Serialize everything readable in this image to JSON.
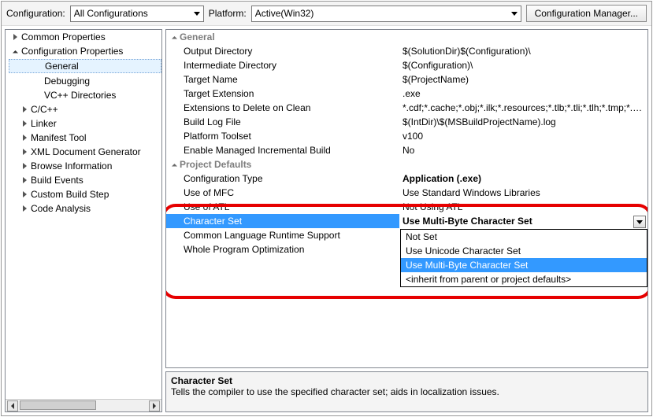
{
  "topbar": {
    "config_label": "Configuration:",
    "config_value": "All Configurations",
    "platform_label": "Platform:",
    "platform_value": "Active(Win32)",
    "manager_btn": "Configuration Manager..."
  },
  "tree": {
    "items": [
      {
        "label": "Common Properties",
        "type": "node",
        "expand": "closed",
        "indent": 0
      },
      {
        "label": "Configuration Properties",
        "type": "node",
        "expand": "open",
        "indent": 0
      },
      {
        "label": "General",
        "type": "leaf",
        "indent": 2,
        "selected": true
      },
      {
        "label": "Debugging",
        "type": "leaf",
        "indent": 2
      },
      {
        "label": "VC++ Directories",
        "type": "leaf",
        "indent": 2
      },
      {
        "label": "C/C++",
        "type": "node",
        "expand": "closed",
        "indent": 1
      },
      {
        "label": "Linker",
        "type": "node",
        "expand": "closed",
        "indent": 1
      },
      {
        "label": "Manifest Tool",
        "type": "node",
        "expand": "closed",
        "indent": 1
      },
      {
        "label": "XML Document Generator",
        "type": "node",
        "expand": "closed",
        "indent": 1
      },
      {
        "label": "Browse Information",
        "type": "node",
        "expand": "closed",
        "indent": 1
      },
      {
        "label": "Build Events",
        "type": "node",
        "expand": "closed",
        "indent": 1
      },
      {
        "label": "Custom Build Step",
        "type": "node",
        "expand": "closed",
        "indent": 1
      },
      {
        "label": "Code Analysis",
        "type": "node",
        "expand": "closed",
        "indent": 1
      }
    ]
  },
  "grid": {
    "groups": [
      {
        "title": "General",
        "rows": [
          {
            "label": "Output Directory",
            "value": "$(SolutionDir)$(Configuration)\\"
          },
          {
            "label": "Intermediate Directory",
            "value": "$(Configuration)\\"
          },
          {
            "label": "Target Name",
            "value": "$(ProjectName)"
          },
          {
            "label": "Target Extension",
            "value": ".exe"
          },
          {
            "label": "Extensions to Delete on Clean",
            "value": "*.cdf;*.cache;*.obj;*.ilk;*.resources;*.tlb;*.tli;*.tlh;*.tmp;*.rsp;"
          },
          {
            "label": "Build Log File",
            "value": "$(IntDir)\\$(MSBuildProjectName).log"
          },
          {
            "label": "Platform Toolset",
            "value": "v100"
          },
          {
            "label": "Enable Managed Incremental Build",
            "value": "No"
          }
        ]
      },
      {
        "title": "Project Defaults",
        "rows": [
          {
            "label": "Configuration Type",
            "value": "Application (.exe)",
            "bold": true
          },
          {
            "label": "Use of MFC",
            "value": "Use Standard Windows Libraries"
          },
          {
            "label": "Use of ATL",
            "value": "Not Using ATL"
          },
          {
            "label": "Character Set",
            "value": "Use Multi-Byte Character Set",
            "selected": true,
            "bold": true
          },
          {
            "label": "Common Language Runtime Support",
            "value": ""
          },
          {
            "label": "Whole Program Optimization",
            "value": ""
          }
        ]
      }
    ],
    "dropdown": {
      "options": [
        {
          "label": "Not Set"
        },
        {
          "label": "Use Unicode Character Set"
        },
        {
          "label": "Use Multi-Byte Character Set",
          "highlight": true
        },
        {
          "label": "<inherit from parent or project defaults>"
        }
      ]
    }
  },
  "desc": {
    "title": "Character Set",
    "body": "Tells the compiler to use the specified character set; aids in localization issues."
  }
}
